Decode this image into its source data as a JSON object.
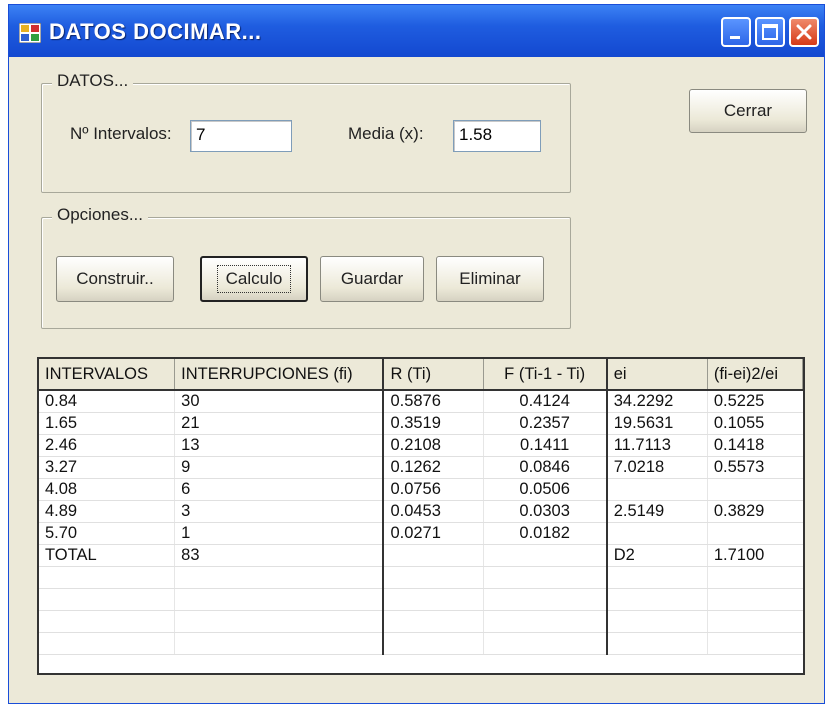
{
  "window": {
    "title": "DATOS DOCIMAR..."
  },
  "datos": {
    "legend": "DATOS...",
    "intervalos_label": "Nº Intervalos:",
    "intervalos_value": "7",
    "media_label": "Media (x):",
    "media_value": "1.58"
  },
  "opciones": {
    "legend": "Opciones...",
    "construir": "Construir..",
    "calculo": "Calculo",
    "guardar": "Guardar",
    "eliminar": "Eliminar"
  },
  "cerrar": "Cerrar",
  "table": {
    "headers": [
      "INTERVALOS",
      "INTERRUPCIONES (fi)",
      "R (Ti)",
      "F (Ti-1 - Ti)",
      "ei",
      "(fi-ei)2/ei"
    ],
    "rows": [
      [
        "0.84",
        "30",
        "0.5876",
        "0.4124",
        "34.2292",
        "0.5225"
      ],
      [
        "1.65",
        "21",
        "0.3519",
        "0.2357",
        "19.5631",
        "0.1055"
      ],
      [
        "2.46",
        "13",
        "0.2108",
        "0.1411",
        "11.7113",
        "0.1418"
      ],
      [
        "3.27",
        "9",
        "0.1262",
        "0.0846",
        "7.0218",
        "0.5573"
      ],
      [
        "4.08",
        "6",
        "0.0756",
        "0.0506",
        "",
        ""
      ],
      [
        "4.89",
        "3",
        "0.0453",
        "0.0303",
        "2.5149",
        "0.3829"
      ],
      [
        "5.70",
        "1",
        "0.0271",
        "0.0182",
        "",
        ""
      ],
      [
        "TOTAL",
        "83",
        "",
        "",
        "D2",
        "1.7100"
      ],
      [
        "",
        "",
        "",
        "",
        "",
        ""
      ],
      [
        "",
        "",
        "",
        "",
        "",
        ""
      ],
      [
        "",
        "",
        "",
        "",
        "",
        ""
      ],
      [
        "",
        "",
        "",
        "",
        "",
        ""
      ]
    ]
  }
}
